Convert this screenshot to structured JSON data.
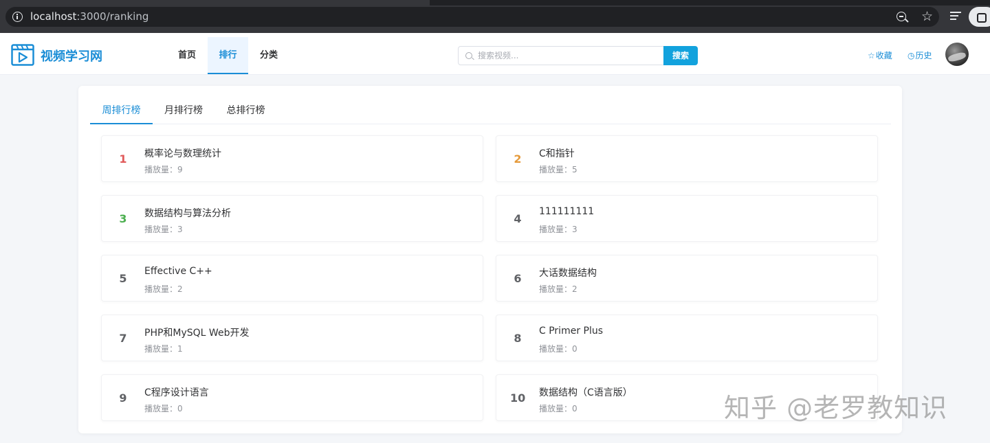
{
  "browser": {
    "url_host": "localhost",
    "url_path": ":3000/ranking"
  },
  "header": {
    "logo_text": "视频学习网",
    "nav": [
      {
        "label": "首页",
        "active": false
      },
      {
        "label": "排行",
        "active": true
      },
      {
        "label": "分类",
        "active": false
      }
    ],
    "search_placeholder": "搜索视频...",
    "search_button": "搜索",
    "favorites_label": "收藏",
    "history_label": "历史"
  },
  "tabs": [
    {
      "label": "周排行榜",
      "active": true
    },
    {
      "label": "月排行榜",
      "active": false
    },
    {
      "label": "总排行榜",
      "active": false
    }
  ],
  "colors": {
    "accent": "#1a8dd6",
    "rank1": "#e05a5a",
    "rank2": "#e59a3b",
    "rank3": "#4caf50"
  },
  "ranking": [
    {
      "rank": "1",
      "title": "概率论与数理统计",
      "plays": "播放量：9"
    },
    {
      "rank": "2",
      "title": "C和指针",
      "plays": "播放量：5"
    },
    {
      "rank": "3",
      "title": "数据结构与算法分析",
      "plays": "播放量：3"
    },
    {
      "rank": "4",
      "title": "111111111",
      "plays": "播放量：3"
    },
    {
      "rank": "5",
      "title": "Effective C++",
      "plays": "播放量：2"
    },
    {
      "rank": "6",
      "title": "大话数据结构",
      "plays": "播放量：2"
    },
    {
      "rank": "7",
      "title": "PHP和MySQL Web开发",
      "plays": "播放量：1"
    },
    {
      "rank": "8",
      "title": "C Primer Plus",
      "plays": "播放量：0"
    },
    {
      "rank": "9",
      "title": "C程序设计语言",
      "plays": "播放量：0"
    },
    {
      "rank": "10",
      "title": "数据结构（C语言版）",
      "plays": "播放量：0"
    }
  ],
  "watermark": "知乎 @老罗教知识"
}
